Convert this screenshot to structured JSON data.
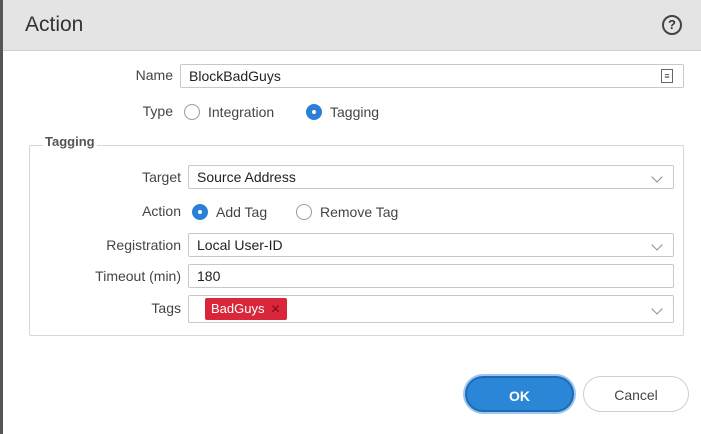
{
  "dialog": {
    "title": "Action",
    "help_icon": "?"
  },
  "form": {
    "name_label": "Name",
    "name_value": "BlockBadGuys",
    "type_label": "Type",
    "type_options": [
      "Integration",
      "Tagging"
    ],
    "type_selected": "Tagging"
  },
  "tagging": {
    "section_title": "Tagging",
    "target_label": "Target",
    "target_value": "Source Address",
    "action_label": "Action",
    "action_options": [
      "Add Tag",
      "Remove Tag"
    ],
    "action_selected": "Add Tag",
    "registration_label": "Registration",
    "registration_value": "Local User-ID",
    "timeout_label": "Timeout (min)",
    "timeout_value": "180",
    "tags_label": "Tags",
    "tags": [
      {
        "label": "BadGuys",
        "color": "#d9263a"
      }
    ]
  },
  "buttons": {
    "ok": "OK",
    "cancel": "Cancel"
  },
  "colors": {
    "accent": "#2b86d8",
    "tag": "#d9263a"
  },
  "icons": {
    "help": "help-icon",
    "notes": "notes-icon",
    "dropdown": "chevron-down-icon",
    "remove_tag": "close-icon"
  }
}
